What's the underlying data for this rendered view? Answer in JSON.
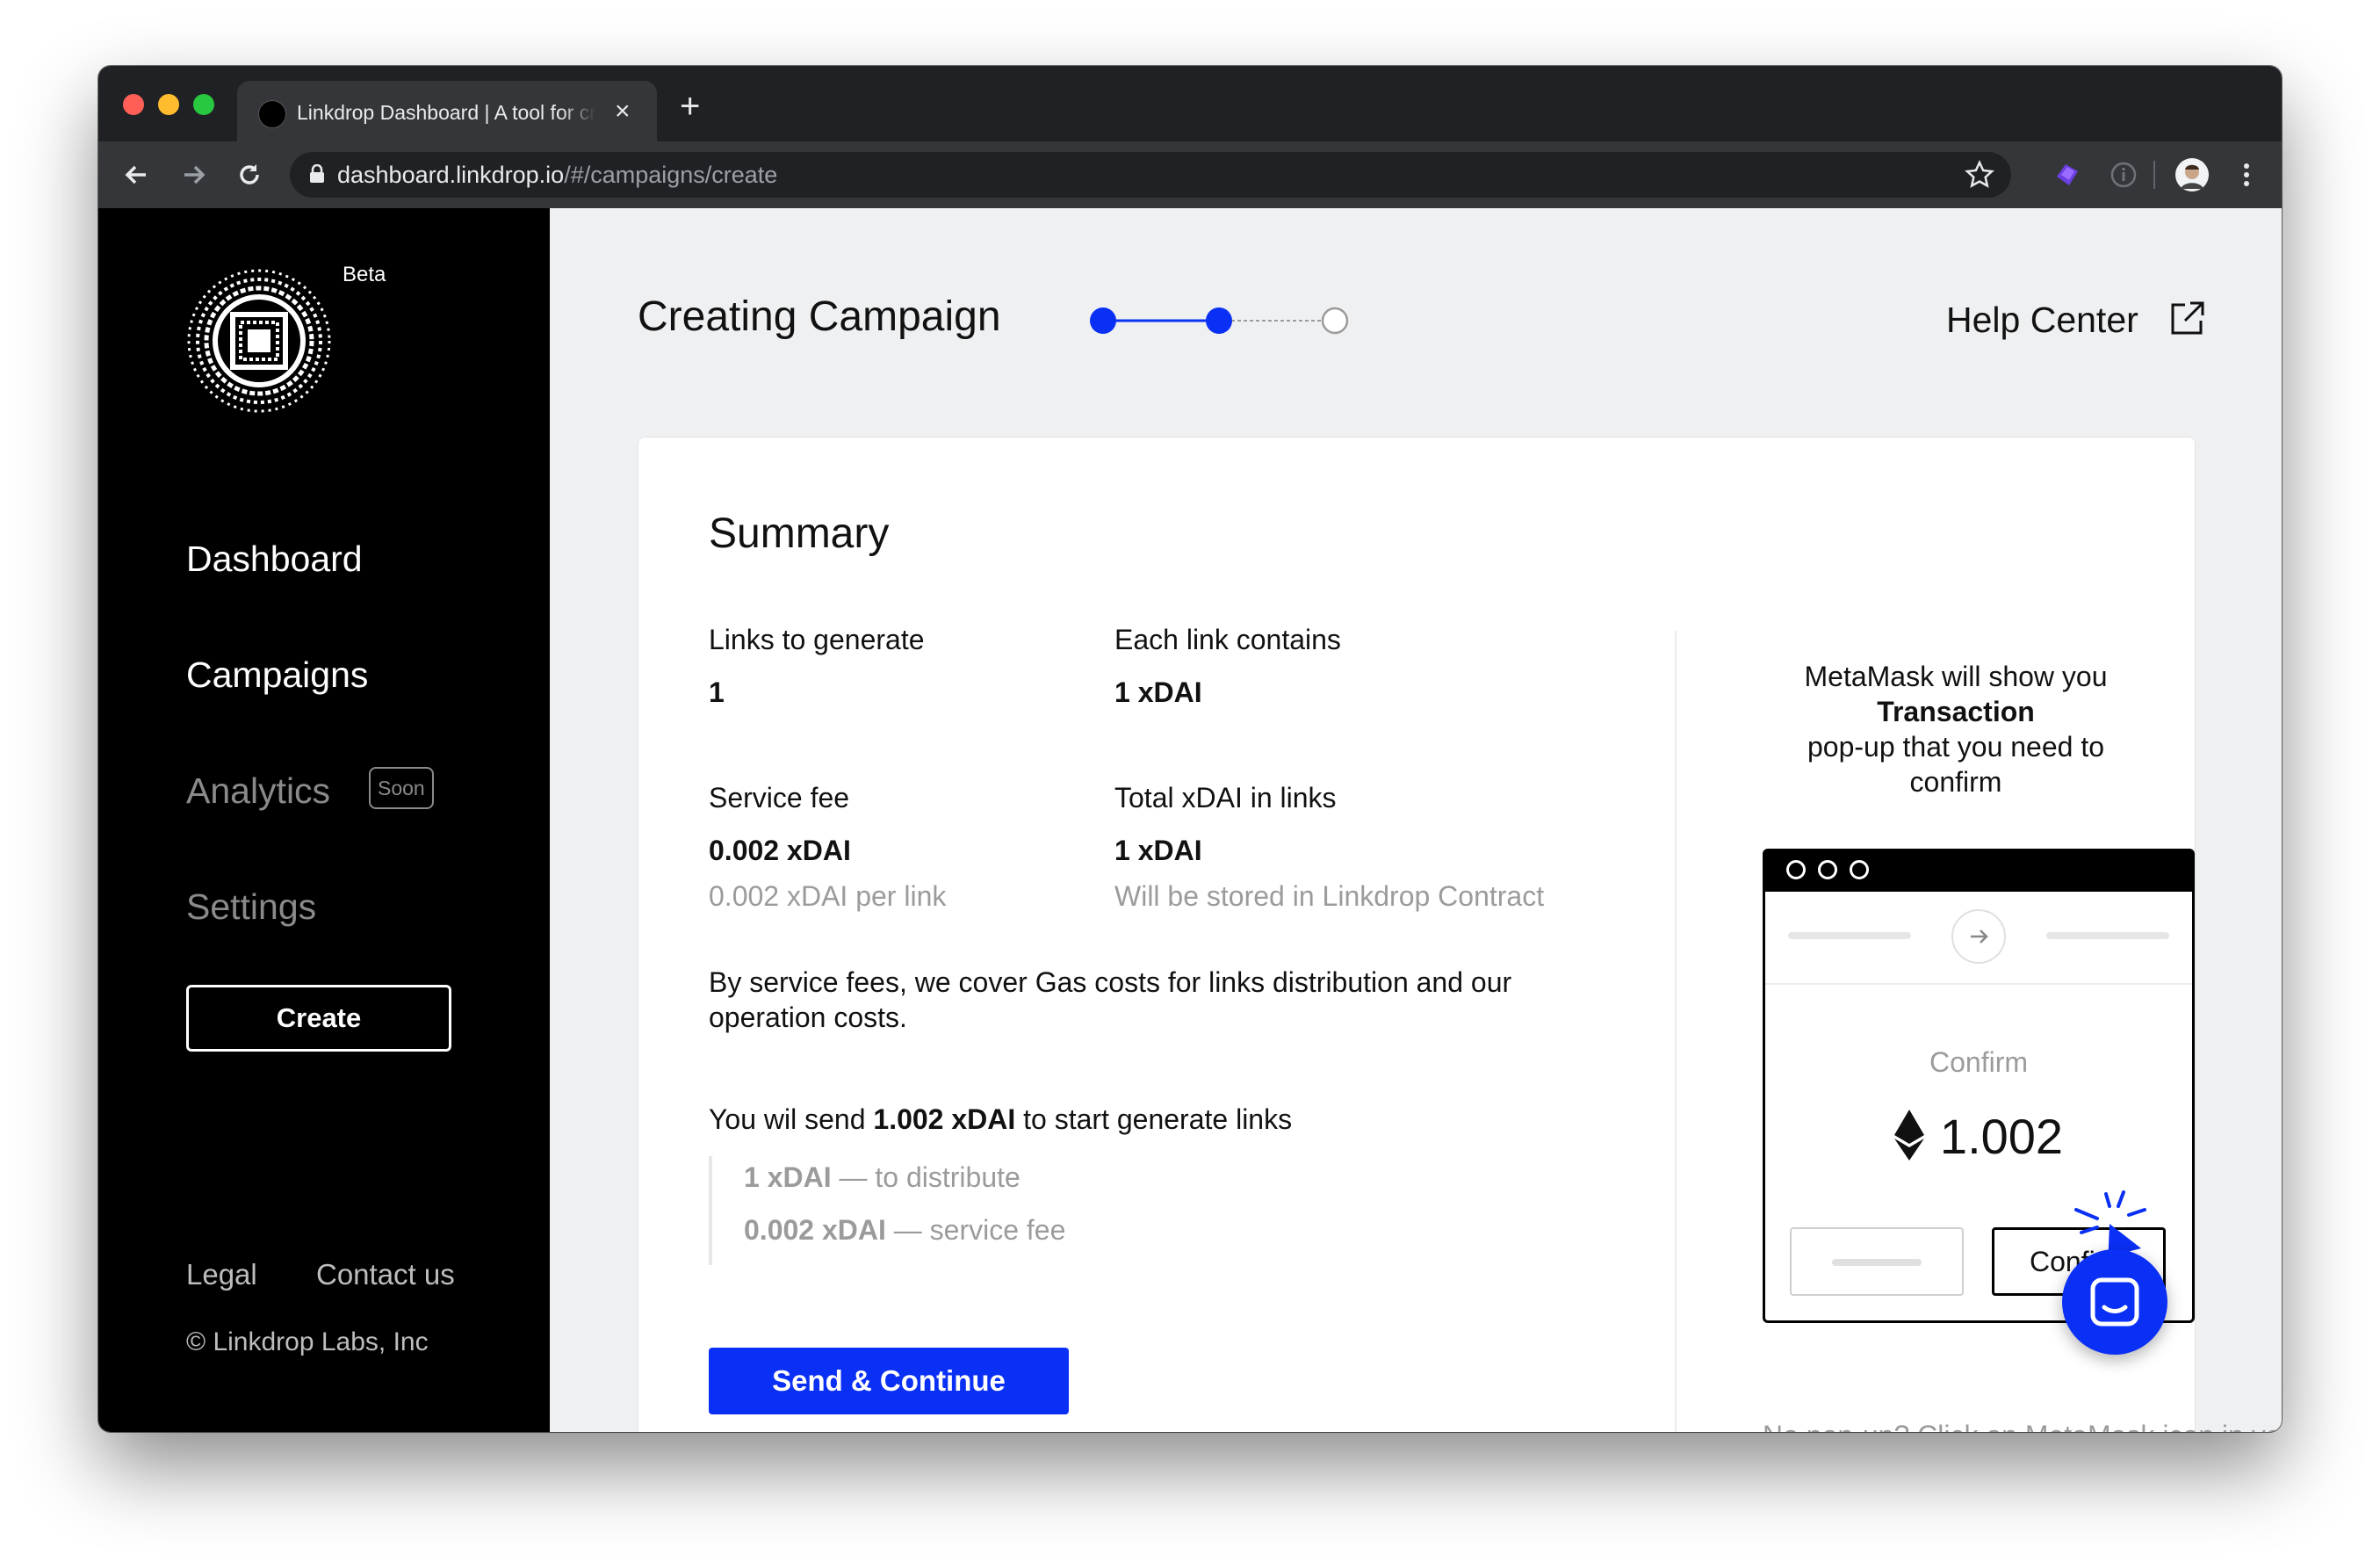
{
  "browser": {
    "tab_title": "Linkdrop Dashboard | A tool for creating campaigns",
    "url_host": "dashboard.linkdrop.io",
    "url_path": "/#/campaigns/create",
    "icons": [
      "close-icon",
      "plus-icon",
      "back-icon",
      "forward-icon",
      "reload-icon",
      "lock-icon",
      "star-icon",
      "extension-icon",
      "info-icon",
      "profile-avatar",
      "menu-dots-icon"
    ]
  },
  "sidebar": {
    "badge": "Beta",
    "nav": {
      "dashboard": "Dashboard",
      "campaigns": "Campaigns",
      "analytics": "Analytics",
      "analytics_tag": "Soon",
      "settings": "Settings"
    },
    "create_label": "Create",
    "footer": {
      "legal": "Legal",
      "contact": "Contact us",
      "copyright": "© Linkdrop Labs, Inc"
    }
  },
  "header": {
    "title": "Creating Campaign",
    "steps_total": 3,
    "steps_completed": 2,
    "help": "Help Center"
  },
  "summary": {
    "title": "Summary",
    "links_to_generate": {
      "label": "Links to generate",
      "value": "1"
    },
    "each_link_contains": {
      "label": "Each link contains",
      "value": "1 xDAI"
    },
    "service_fee": {
      "label": "Service fee",
      "value": "0.002 xDAI",
      "note": "0.002 xDAI per link"
    },
    "total_in_links": {
      "label": "Total xDAI in links",
      "value": "1 xDAI",
      "note": "Will be stored in Linkdrop Contract"
    },
    "fee_explanation": "By service fees, we cover Gas costs for links distribution and our operation costs.",
    "send_prefix": "You wil send ",
    "send_amount": "1.002 xDAI",
    "send_suffix": " to start generate links",
    "breakdown": [
      {
        "amount": "1 xDAI",
        "desc": " — to distribute"
      },
      {
        "amount": "0.002 xDAI",
        "desc": " — service fee"
      }
    ],
    "send_button": "Send & Continue"
  },
  "metamask": {
    "line1": "MetaMask will show you",
    "line2": "Transaction",
    "line3": "pop-up that you need to confirm",
    "confirm_title": "Confirm",
    "amount": "1.002",
    "accept_label": "Confirm",
    "no_popup": "No pop-up? Click on MetaMask icon in your browser"
  },
  "colors": {
    "accent": "#0b30f5",
    "sidebar_bg": "#000000",
    "page_bg": "#eff0f2",
    "muted": "#9b9b9b"
  }
}
